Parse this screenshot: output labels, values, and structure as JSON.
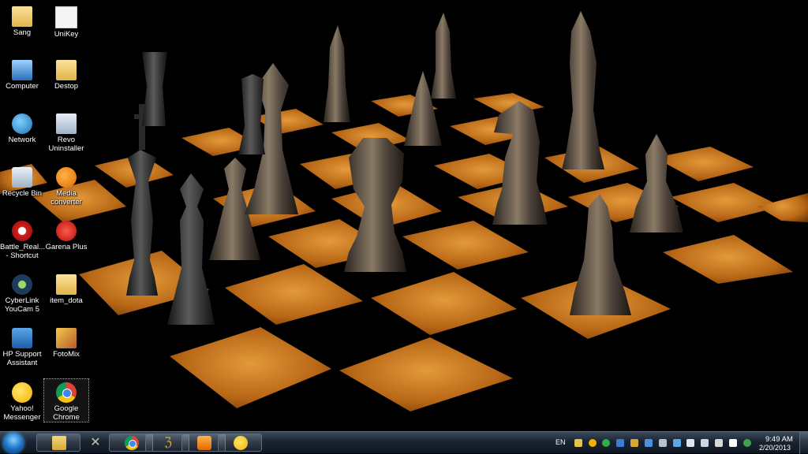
{
  "desktop": {
    "icons": [
      {
        "label": "Sang",
        "icon": "folder-icon"
      },
      {
        "label": "UniKey",
        "icon": "unikey-icon"
      },
      {
        "label": "Computer",
        "icon": "computer-icon"
      },
      {
        "label": "Destop",
        "icon": "folder-icon"
      },
      {
        "label": "Network",
        "icon": "network-icon"
      },
      {
        "label": "Revo Uninstaller",
        "icon": "revo-uninstaller-icon"
      },
      {
        "label": "Recycle Bin",
        "icon": "recycle-bin-icon"
      },
      {
        "label": "Media converter",
        "icon": "media-converter-icon"
      },
      {
        "label": "Battle_Real... - Shortcut",
        "icon": "battle-shortcut-icon"
      },
      {
        "label": "Garena Plus",
        "icon": "garena-icon"
      },
      {
        "label": "CyberLink YouCam 5",
        "icon": "youcam-icon"
      },
      {
        "label": "item_dota",
        "icon": "folder-icon"
      },
      {
        "label": "HP Support Assistant",
        "icon": "hp-support-icon"
      },
      {
        "label": "FotoMix",
        "icon": "fotomix-icon"
      },
      {
        "label": "Yahoo! Messenger",
        "icon": "yahoo-messenger-icon"
      },
      {
        "label": "Google Chrome",
        "icon": "chrome-icon"
      }
    ]
  },
  "taskbar": {
    "pinned": [
      "explorer-icon",
      "game-icon",
      "chrome-icon",
      "game-icon",
      "media-player-icon",
      "yahoo-messenger-icon"
    ],
    "language": "EN",
    "clock_time": "9:49 AM",
    "clock_date": "2/20/2013"
  },
  "colors": {
    "board_light": "#c9761c",
    "board_dark": "#050505",
    "taskbar": "#1a2432"
  }
}
